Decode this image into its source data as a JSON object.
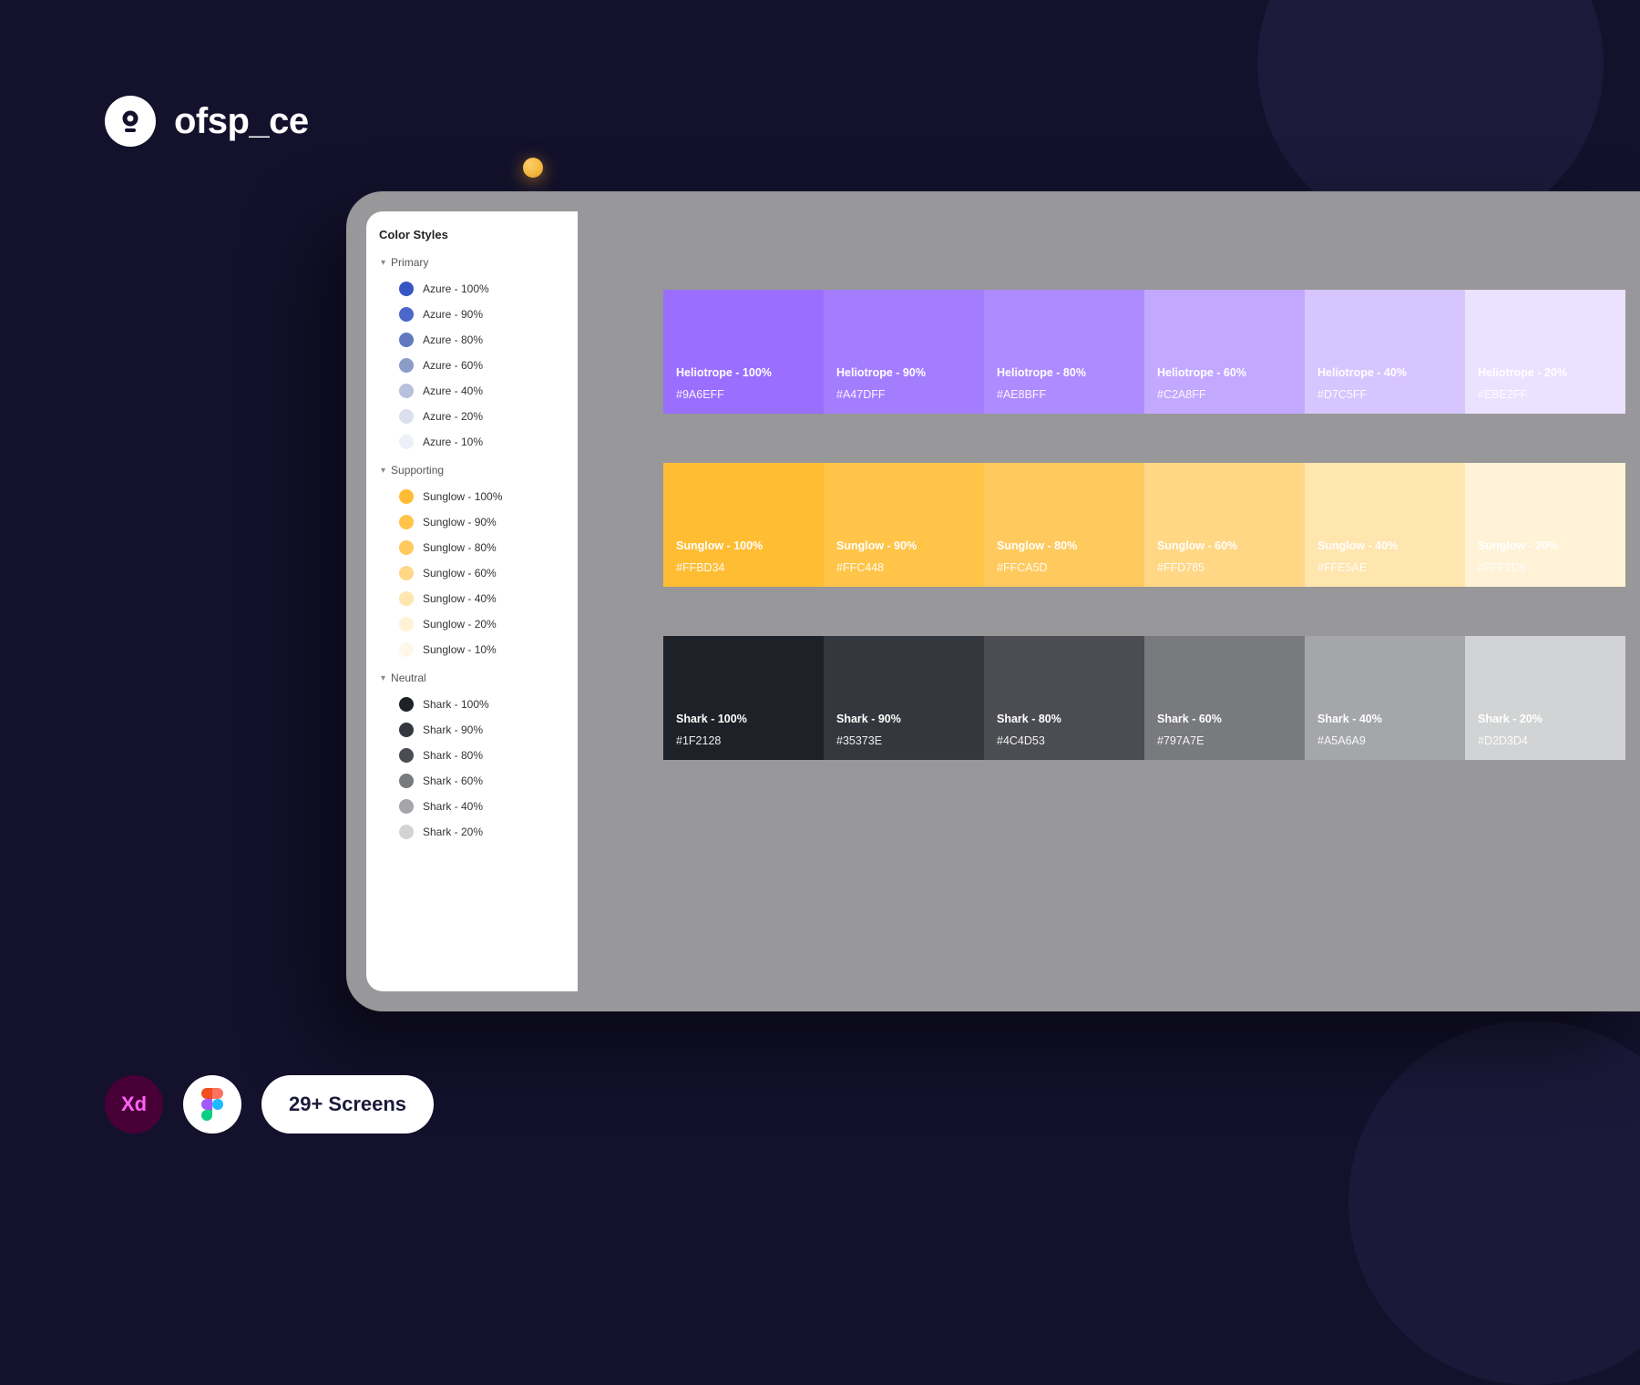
{
  "brand": {
    "name": "ofsp_ce"
  },
  "sidebar": {
    "title": "Color Styles",
    "groups": [
      {
        "name": "Primary",
        "items": [
          {
            "label": "Azure - 100%",
            "color": "#3656c4"
          },
          {
            "label": "Azure - 90%",
            "color": "#4a67c9"
          },
          {
            "label": "Azure - 80%",
            "color": "#6279c2"
          },
          {
            "label": "Azure - 60%",
            "color": "#8c9cc9"
          },
          {
            "label": "Azure - 40%",
            "color": "#b7c0dc"
          },
          {
            "label": "Azure - 20%",
            "color": "#dbe0ee"
          },
          {
            "label": "Azure - 10%",
            "color": "#edf0f8"
          }
        ]
      },
      {
        "name": "Supporting",
        "items": [
          {
            "label": "Sunglow - 100%",
            "color": "#FFBD34"
          },
          {
            "label": "Sunglow - 90%",
            "color": "#FFC448"
          },
          {
            "label": "Sunglow - 80%",
            "color": "#FFCA5D"
          },
          {
            "label": "Sunglow - 60%",
            "color": "#FFD785"
          },
          {
            "label": "Sunglow - 40%",
            "color": "#FFE5AE"
          },
          {
            "label": "Sunglow - 20%",
            "color": "#FFF2D6"
          },
          {
            "label": "Sunglow - 10%",
            "color": "#FFF8EA"
          }
        ]
      },
      {
        "name": "Neutral",
        "items": [
          {
            "label": "Shark - 100%",
            "color": "#1F2128"
          },
          {
            "label": "Shark - 90%",
            "color": "#35373E"
          },
          {
            "label": "Shark - 80%",
            "color": "#4C4D53"
          },
          {
            "label": "Shark - 60%",
            "color": "#797A7E"
          },
          {
            "label": "Shark - 40%",
            "color": "#A5A6A9"
          },
          {
            "label": "Shark - 20%",
            "color": "#D2D3D4"
          }
        ]
      }
    ]
  },
  "palettes": [
    {
      "cells": [
        {
          "name": "Heliotrope - 100%",
          "hex": "#9A6EFF",
          "bg": "#9A6EFF"
        },
        {
          "name": "Heliotrope - 90%",
          "hex": "#A47DFF",
          "bg": "#A47DFF"
        },
        {
          "name": "Heliotrope - 80%",
          "hex": "#AE8BFF",
          "bg": "#AE8BFF"
        },
        {
          "name": "Heliotrope - 60%",
          "hex": "#C2A8FF",
          "bg": "#C2A8FF"
        },
        {
          "name": "Heliotrope - 40%",
          "hex": "#D7C5FF",
          "bg": "#D7C5FF"
        },
        {
          "name": "Heliotrope - 20%",
          "hex": "#EBE2FF",
          "bg": "#EBE2FF"
        }
      ]
    },
    {
      "cells": [
        {
          "name": "Sunglow - 100%",
          "hex": "#FFBD34",
          "bg": "#FFBD34"
        },
        {
          "name": "Sunglow - 90%",
          "hex": "#FFC448",
          "bg": "#FFC448"
        },
        {
          "name": "Sunglow - 80%",
          "hex": "#FFCA5D",
          "bg": "#FFCA5D"
        },
        {
          "name": "Sunglow - 60%",
          "hex": "#FFD785",
          "bg": "#FFD785"
        },
        {
          "name": "Sunglow - 40%",
          "hex": "#FFE5AE",
          "bg": "#FFE5AE"
        },
        {
          "name": "Sunglow - 20%",
          "hex": "#FFF2D6",
          "bg": "#FFF2D6"
        }
      ]
    },
    {
      "cells": [
        {
          "name": "Shark - 100%",
          "hex": "#1F2128",
          "bg": "#1F2128"
        },
        {
          "name": "Shark - 90%",
          "hex": "#35373E",
          "bg": "#35373E"
        },
        {
          "name": "Shark - 80%",
          "hex": "#4C4D53",
          "bg": "#4C4D53"
        },
        {
          "name": "Shark - 60%",
          "hex": "#797A7E",
          "bg": "#797A7E"
        },
        {
          "name": "Shark - 40%",
          "hex": "#A5A6A9",
          "bg": "#A5A6A9"
        },
        {
          "name": "Shark - 20%",
          "hex": "#D2D3D4",
          "bg": "#D2D3D4"
        }
      ]
    }
  ],
  "footer": {
    "xd_label": "Xd",
    "screens_label": "29+ Screens"
  }
}
